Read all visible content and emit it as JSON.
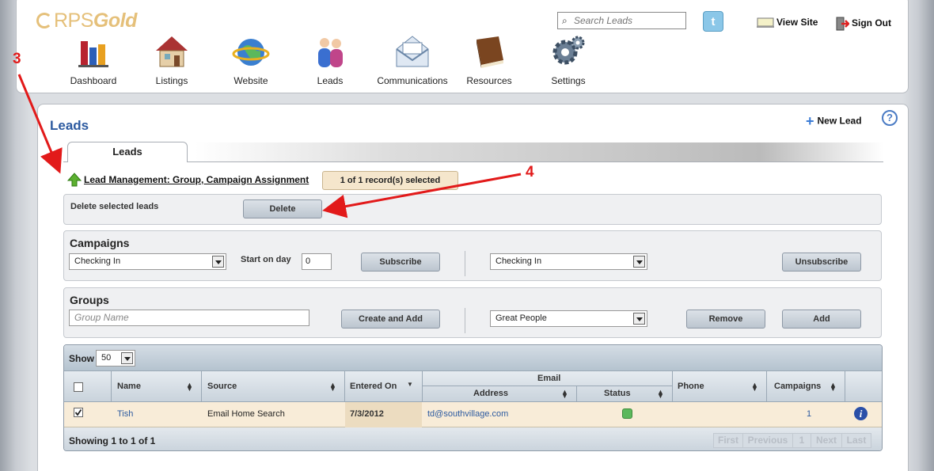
{
  "brand": {
    "prefix": "RPS",
    "suffix": "Gold"
  },
  "search": {
    "placeholder": "Search Leads"
  },
  "top_links": {
    "twitter": "t",
    "view_site": "View Site",
    "sign_out": "Sign Out"
  },
  "nav": [
    {
      "label": "Dashboard",
      "icon": "dashboard-chart-icon"
    },
    {
      "label": "Listings",
      "icon": "house-icon"
    },
    {
      "label": "Website",
      "icon": "globe-icon"
    },
    {
      "label": "Leads",
      "icon": "people-icon"
    },
    {
      "label": "Communications",
      "icon": "envelope-icon"
    },
    {
      "label": "Resources",
      "icon": "book-icon"
    },
    {
      "label": "Settings",
      "icon": "gears-icon"
    }
  ],
  "page": {
    "title": "Leads",
    "new_lead": "New Lead",
    "help": "?",
    "tab": "Leads"
  },
  "lead_mgmt": {
    "link": "Lead Management: Group, Campaign Assignment",
    "selected": "1 of 1 record(s) selected"
  },
  "delete_box": {
    "label": "Delete selected leads",
    "button": "Delete"
  },
  "campaigns": {
    "title": "Campaigns",
    "subscribe_campaign": "Checking In",
    "start_label": "Start on day",
    "start_value": "0",
    "subscribe": "Subscribe",
    "unsubscribe_campaign": "Checking In",
    "unsubscribe": "Unsubscribe"
  },
  "groups": {
    "title": "Groups",
    "name_placeholder": "Group Name",
    "create_add": "Create and Add",
    "group_select": "Great People",
    "remove": "Remove",
    "add": "Add"
  },
  "grid": {
    "show_label": "Show",
    "page_size": "50",
    "columns": {
      "name": "Name",
      "source": "Source",
      "entered_on": "Entered On",
      "email_group": "Email",
      "address": "Address",
      "status": "Status",
      "phone": "Phone",
      "campaigns": "Campaigns"
    },
    "rows": [
      {
        "checked": true,
        "name": "Tish",
        "source": "Email Home Search",
        "entered_on": "7/3/2012",
        "address": "td@southvillage.com",
        "status": "green",
        "phone": "",
        "campaigns": "1"
      }
    ],
    "summary": "Showing 1 to 1 of 1",
    "pager": {
      "first": "First",
      "previous": "Previous",
      "page": "1",
      "next": "Next",
      "last": "Last"
    }
  },
  "annotations": {
    "step3": "3",
    "step4": "4"
  },
  "colors": {
    "accent_blue": "#2c5aa0",
    "annotation_red": "#e21a1a",
    "row_highlight": "#f8ecd8",
    "status_green": "#5cb85c",
    "logo_gold": "#e5c07a"
  }
}
